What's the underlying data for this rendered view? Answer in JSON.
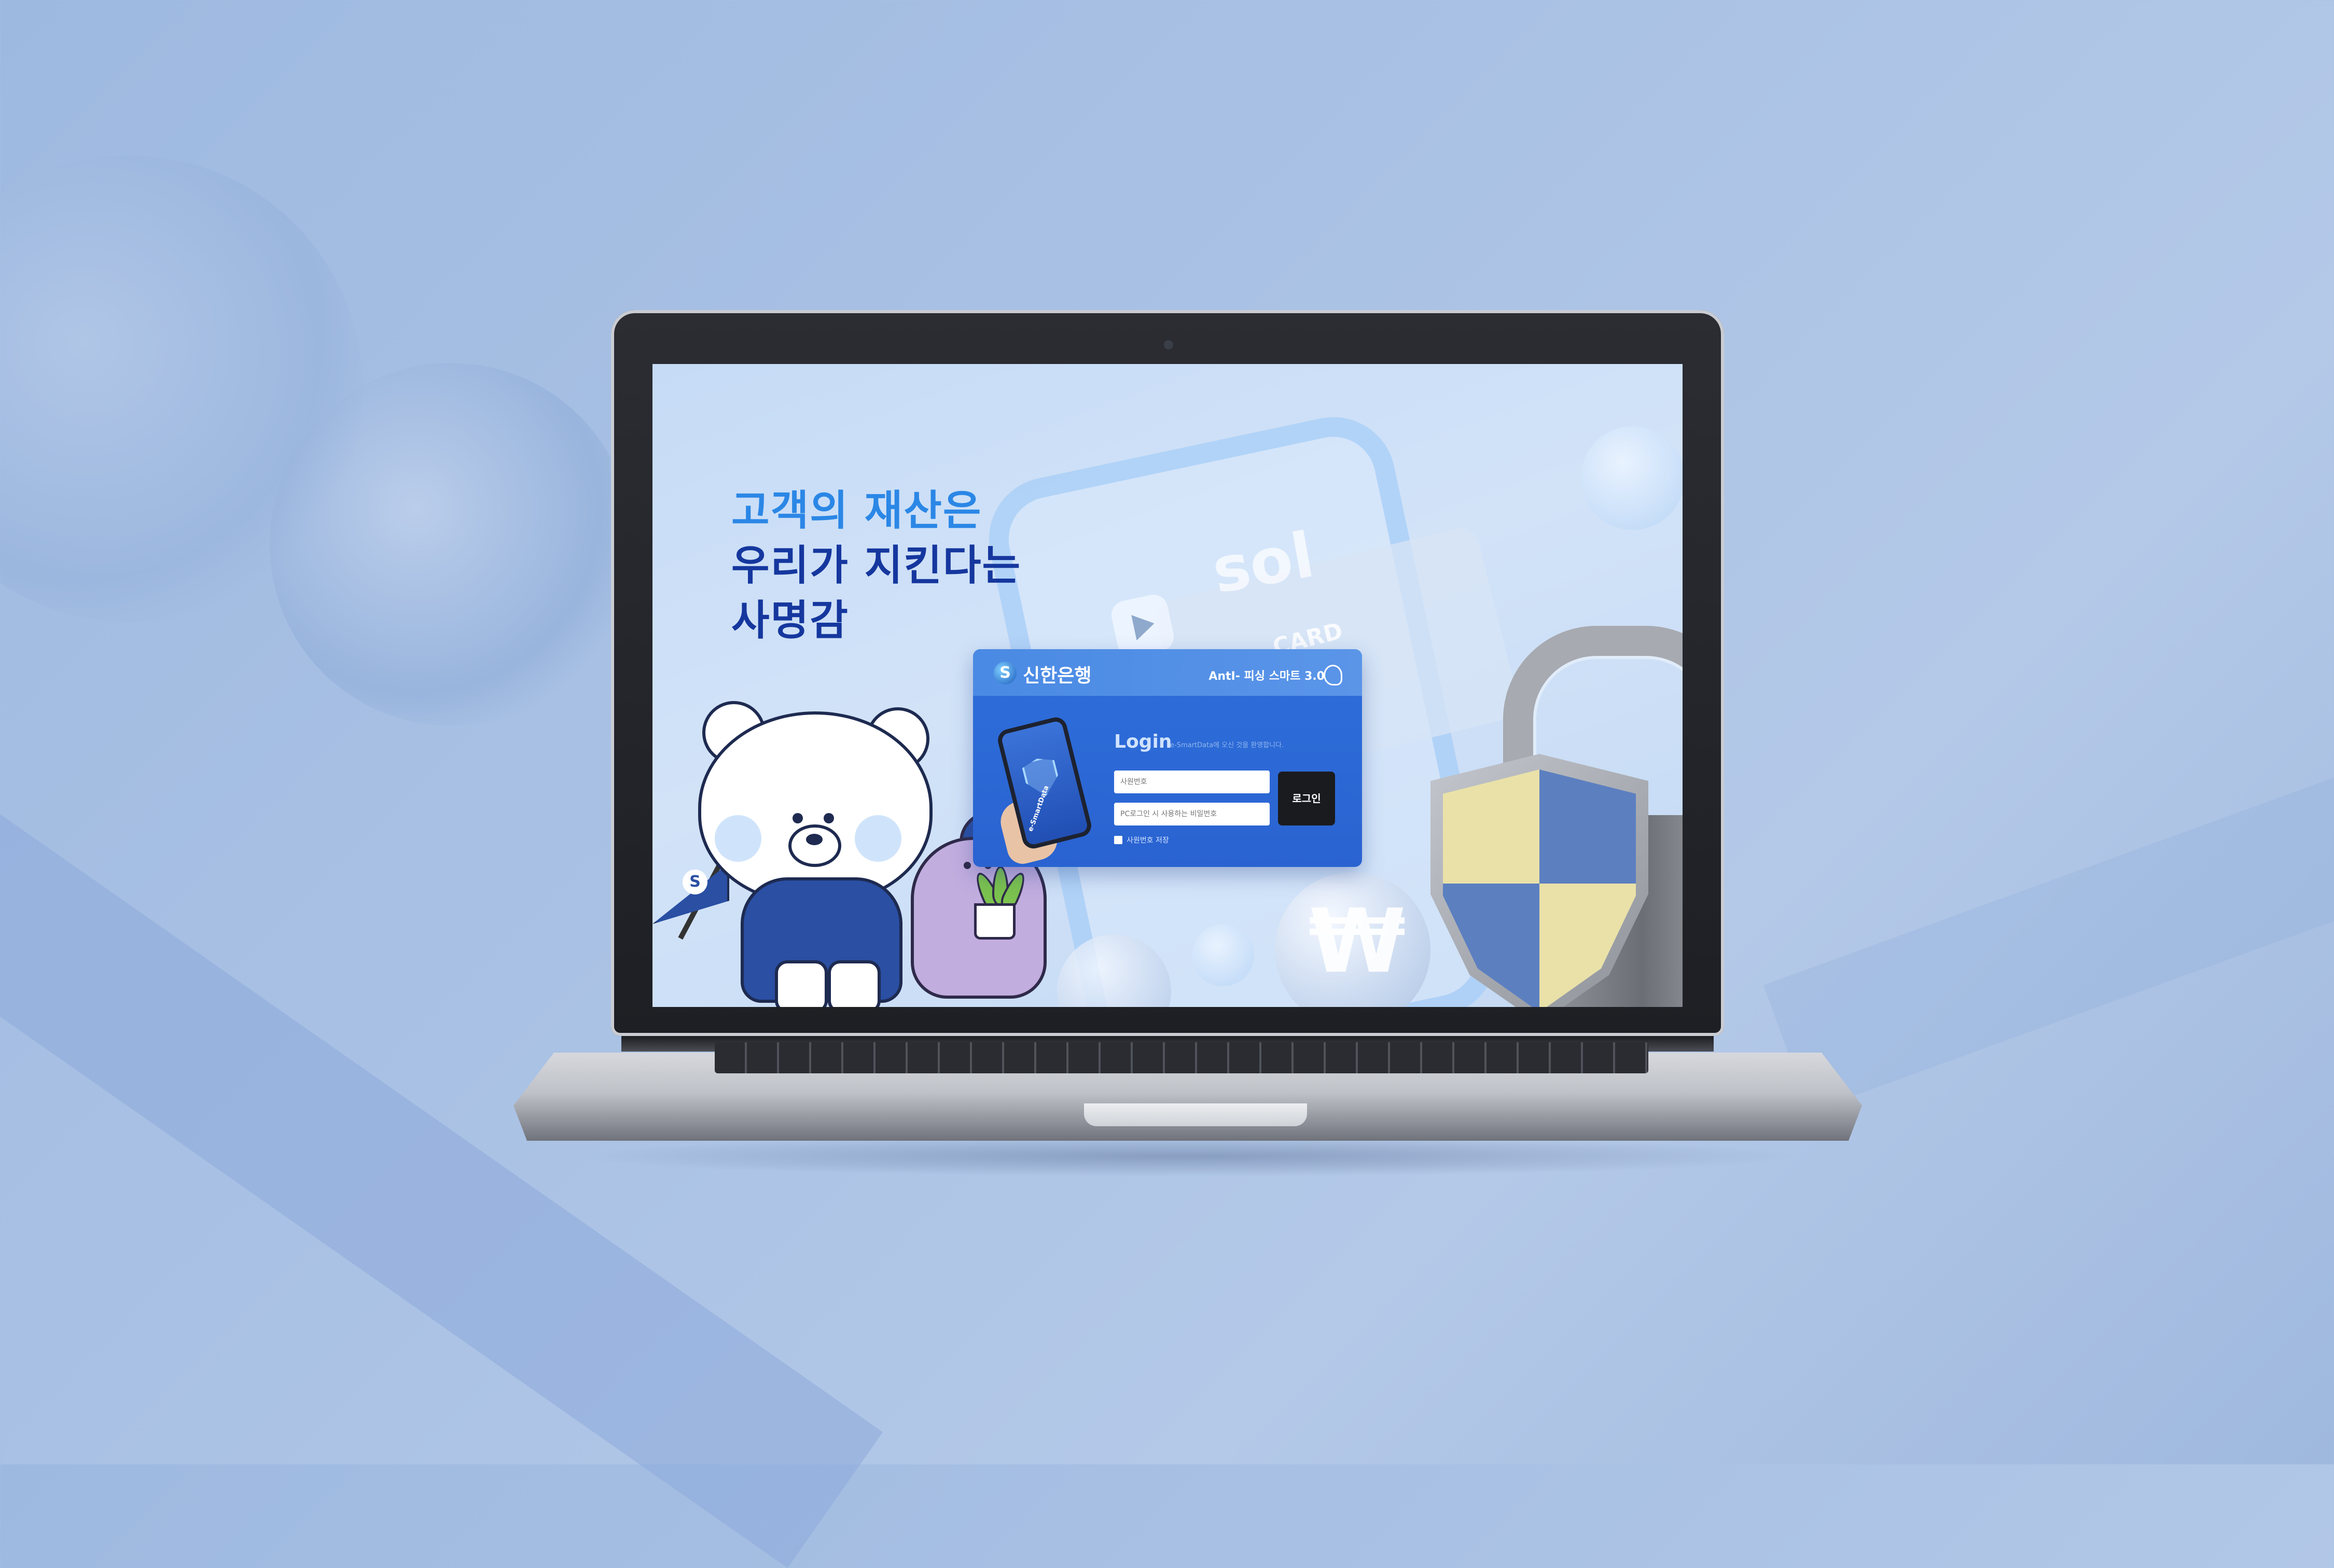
{
  "screen": {
    "headline": {
      "line1": "고객의 재산은",
      "line2": "우리가 지킨다는",
      "line3": "사명감"
    },
    "deco": {
      "app_logo": "sol",
      "card_text": "CARD",
      "coin_symbol": "₩"
    },
    "login_panel": {
      "bank_name": "신한은행",
      "bank_logo_letter": "S",
      "anti_title": "AntI- 피싱 스마트 3.0",
      "title": "Login",
      "subtitle": "e-SmartData에 오신 것을 환영합니다.",
      "phone_label": "e-SmartData",
      "id_placeholder": "사원번호",
      "pw_placeholder": "PC로그인 시 사용하는 비밀번호",
      "login_button": "로그인",
      "save_id_label": "사원번호 저장"
    },
    "mascot_flag_letter": "S"
  },
  "colors": {
    "headline_dark": "#15379e",
    "headline_accent": "#2b87e6",
    "panel_blue": "#2e6fdb",
    "login_button": "#1a1b1f"
  }
}
